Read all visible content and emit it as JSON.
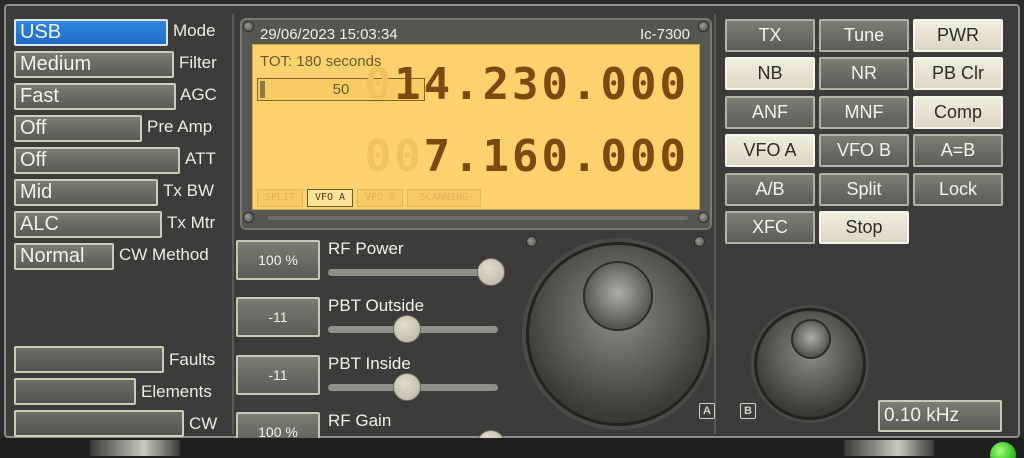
{
  "left": {
    "rows": [
      {
        "value": "USB",
        "label": "Mode",
        "active": true
      },
      {
        "value": "Medium",
        "label": "Filter"
      },
      {
        "value": "Fast",
        "label": "AGC"
      },
      {
        "value": "Off",
        "label": "Pre Amp"
      },
      {
        "value": "Off",
        "label": "ATT"
      },
      {
        "value": "Mid",
        "label": "Tx BW"
      },
      {
        "value": "ALC",
        "label": "Tx Mtr"
      },
      {
        "value": "Normal",
        "label": "CW Method"
      }
    ],
    "bottom_rows": [
      {
        "value": "",
        "label": "Faults"
      },
      {
        "value": "",
        "label": "Elements"
      },
      {
        "value": "",
        "label": "CW"
      }
    ]
  },
  "lcd": {
    "datetime": "29/06/2023 15:03:34",
    "model": "Ic-7300",
    "tot": "TOT: 180 seconds",
    "squelch": "50",
    "freq_a_ghost": "0",
    "freq_a": "14.230.000",
    "freq_b_ghost": "00",
    "freq_b": "7.160.000",
    "tags": [
      {
        "label": "SPLIT",
        "on": false
      },
      {
        "label": "VFO A",
        "on": true
      },
      {
        "label": "VFO B",
        "on": false
      },
      {
        "label": "SCANNING",
        "on": false
      }
    ]
  },
  "sliders": [
    {
      "button": "100 %",
      "label": "RF Power",
      "level": 1.0
    },
    {
      "button": "-11",
      "label": "PBT Outside",
      "level": 0.46
    },
    {
      "button": "-11",
      "label": "PBT Inside",
      "level": 0.46
    },
    {
      "button": "100 %",
      "label": "RF Gain",
      "level": 1.0
    }
  ],
  "knobs": {
    "a_label": "A",
    "b_label": "B"
  },
  "right": {
    "buttons": [
      [
        "TX",
        "Tune",
        "PWR"
      ],
      [
        "NB",
        "NR",
        "PB Clr"
      ],
      [
        "ANF",
        "MNF",
        "Comp"
      ],
      [
        "VFO A",
        "VFO B",
        "A=B"
      ],
      [
        "A/B",
        "Split",
        "Lock"
      ],
      [
        "XFC",
        "Stop",
        ""
      ]
    ],
    "step": "0.10 kHz"
  }
}
